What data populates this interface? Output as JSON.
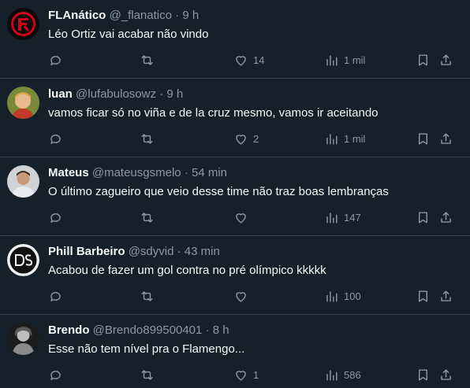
{
  "tweets": [
    {
      "name": "FLAnático",
      "handle": "@_flanatico",
      "time": "9 h",
      "text": "Léo Ortiz vai acabar não vindo",
      "likes": "14",
      "views": "1 mil",
      "avatar": "flamengo-crest-avatar"
    },
    {
      "name": "luan",
      "handle": "@lufabulosowz",
      "time": "9 h",
      "text": "vamos ficar só no viña e de la cruz mesmo, vamos ir aceitando",
      "likes": "2",
      "views": "1 mil",
      "avatar": "child-photo-avatar"
    },
    {
      "name": "Mateus",
      "handle": "@mateusgsmelo",
      "time": "54 min",
      "text": "O último zagueiro que veio desse time não traz boas lembranças",
      "likes": "",
      "views": "147",
      "avatar": "person-photo-avatar"
    },
    {
      "name": "Phill Barbeiro",
      "handle": "@sdyvid",
      "time": "43 min",
      "text": "Acabou de fazer um gol contra no pré olímpico kkkkk",
      "likes": "",
      "views": "100",
      "avatar": "ds-logo-avatar"
    },
    {
      "name": "Brendo",
      "handle": "@Brendo899500401",
      "time": "8 h",
      "text": "Esse não tem nível pra o Flamengo...",
      "likes": "1",
      "views": "586",
      "avatar": "grayscale-photo-avatar"
    }
  ],
  "separator": "·",
  "colors": {
    "background": "#15202b",
    "text": "#f7f9f9",
    "muted": "#8b98a5",
    "divider": "#38444d"
  }
}
